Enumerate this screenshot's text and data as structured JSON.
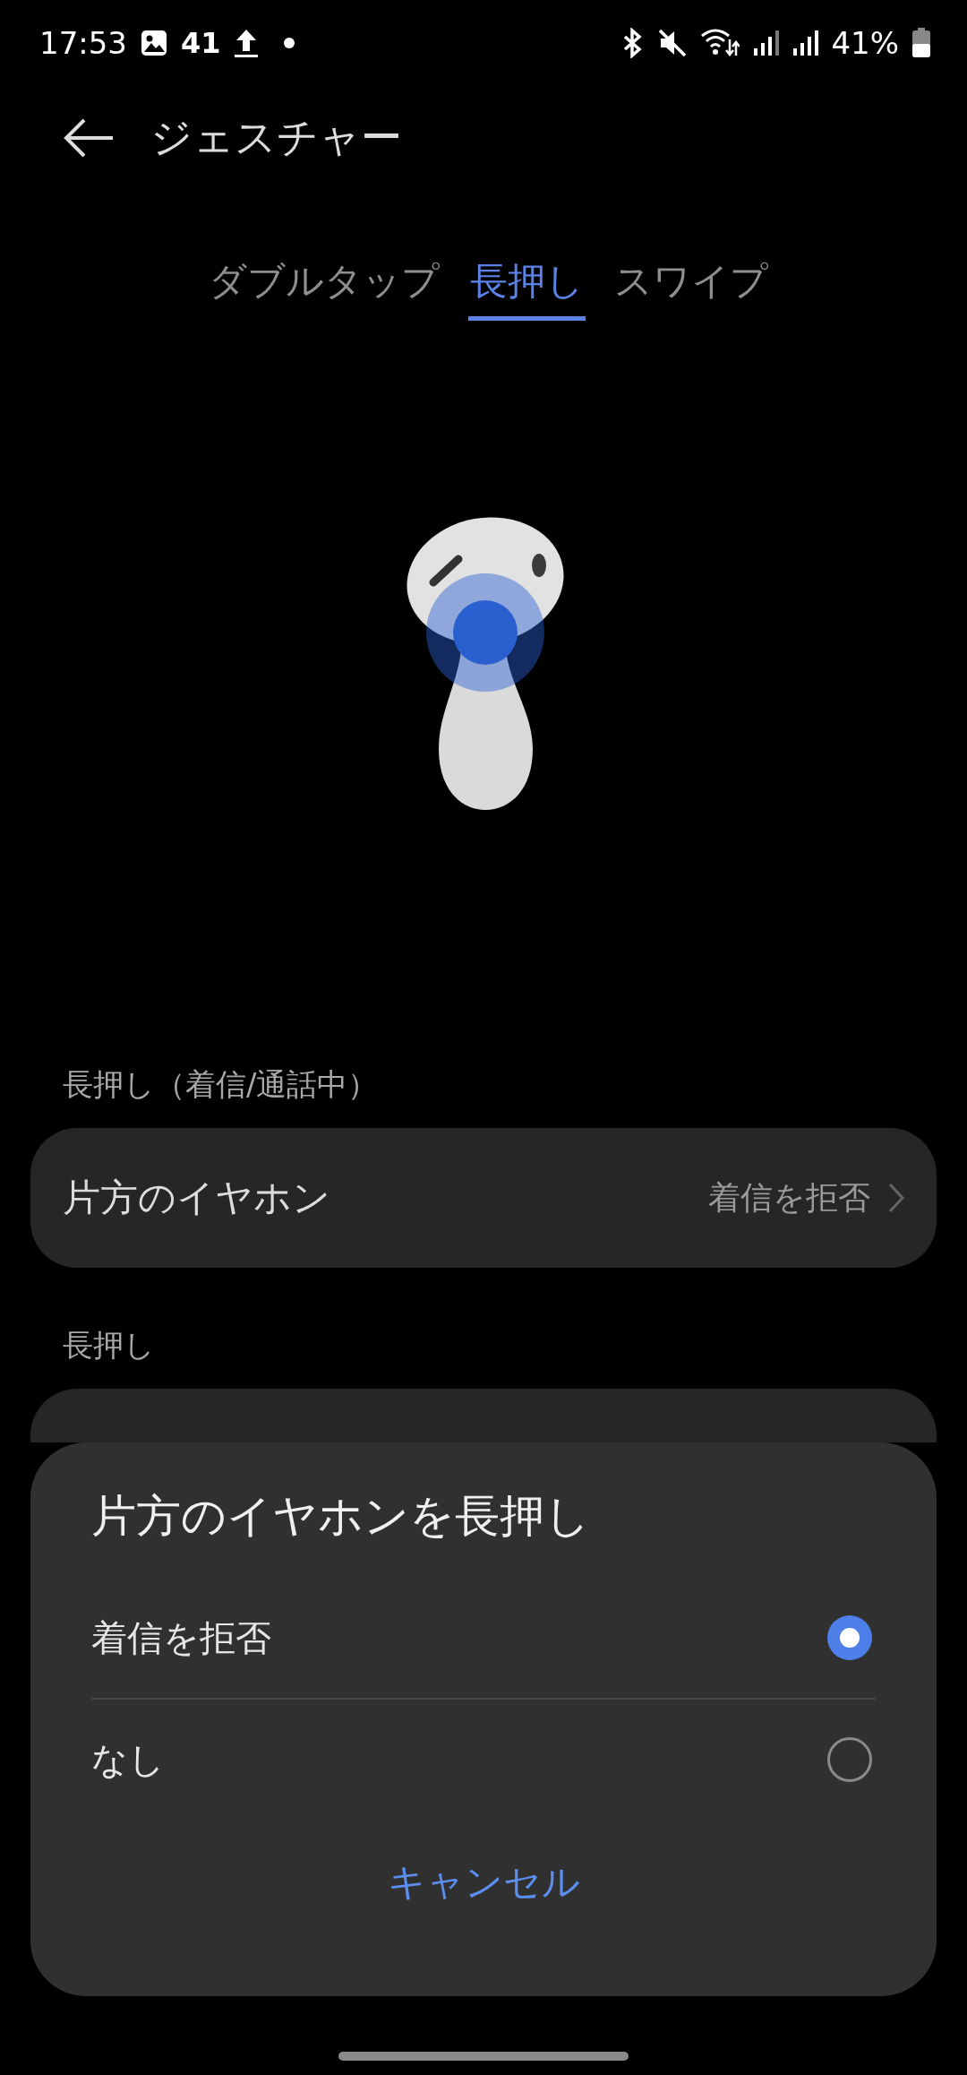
{
  "status_bar": {
    "time": "17:53",
    "notification_count": "41",
    "battery": "41%"
  },
  "header": {
    "title": "ジェスチャー"
  },
  "tabs": [
    {
      "label": "ダブルタップ",
      "selected": false
    },
    {
      "label": "長押し",
      "selected": true
    },
    {
      "label": "スワイプ",
      "selected": false
    }
  ],
  "sections": [
    {
      "label": "長押し（着信/通話中）",
      "rows": [
        {
          "kind": "row",
          "label": "片方のイヤホン",
          "value": "着信を拒否"
        }
      ]
    },
    {
      "label": "長押し",
      "rows": [
        {
          "kind": "covered"
        }
      ]
    }
  ],
  "sheet": {
    "title": "片方のイヤホンを長押し",
    "options": [
      {
        "label": "着信を拒否",
        "selected": true
      },
      {
        "label": "なし",
        "selected": false
      }
    ],
    "cancel": "キャンセル"
  }
}
